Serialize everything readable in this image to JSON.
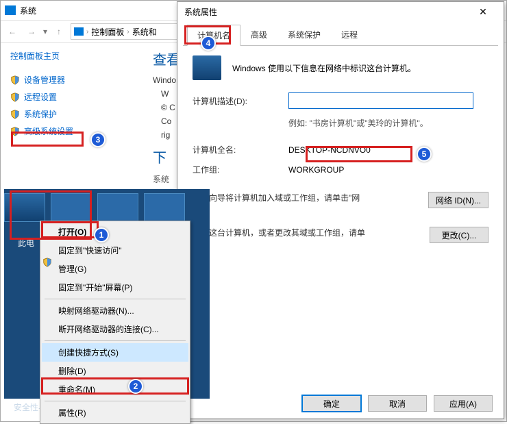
{
  "cp": {
    "title": "系统",
    "breadcrumb": {
      "item1": "控制面板",
      "item2": "系统和"
    },
    "home": "控制面板主页",
    "links": {
      "device_mgr": "设备管理器",
      "remote": "远程设置",
      "protect": "系统保护",
      "advanced": "高级系统设置"
    },
    "main": {
      "heading": "查看",
      "line1": "Windo",
      "line2": "W",
      "line3": "© C",
      "line4": "Co",
      "line5": "rig",
      "download": "下",
      "sys_label": "系统"
    }
  },
  "ctx": {
    "pc_label": "此电",
    "items": {
      "open": "打开(O)",
      "pin_quick": "固定到\"快速访问\"",
      "manage": "管理(G)",
      "pin_start": "固定到\"开始\"屏幕(P)",
      "map_drive": "映射网络驱动器(N)...",
      "disconnect": "断开网络驱动器的连接(C)...",
      "shortcut": "创建快捷方式(S)",
      "delete": "删除(D)",
      "rename": "重命名(M)",
      "properties": "属性(R)"
    },
    "safety": "安全性与"
  },
  "dlg": {
    "title": "系统属性",
    "close": "✕",
    "tabs": {
      "name": "计算机名",
      "advanced": "高级",
      "protect": "系统保护",
      "remote": "远程"
    },
    "hero": "Windows 使用以下信息在网络中标识这台计算机。",
    "desc_label": "计算机描述(D):",
    "desc_value": "",
    "desc_hint": "例如: \"书房计算机\"或\"美玲的计算机\"。",
    "fullname_label": "计算机全名:",
    "fullname_value": "DESKTOP-NCDNVO0",
    "workgroup_label": "工作组:",
    "workgroup_value": "WORKGROUP",
    "wizard_text": "使用向导将计算机加入域或工作组，请单击\"网",
    "netid_btn": "网络 ID(N)...",
    "rename_text": "命名这台计算机，或者更改其域或工作组，请单击\"",
    "change_btn": "更改(C)...",
    "ok": "确定",
    "cancel": "取消",
    "apply": "应用(A)"
  },
  "callouts": {
    "c1": "1",
    "c2": "2",
    "c3": "3",
    "c4": "4",
    "c5": "5"
  }
}
